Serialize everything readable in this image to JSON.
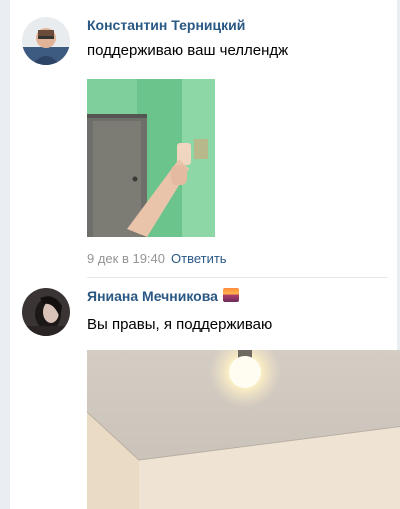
{
  "comments": [
    {
      "author": "Константин Терницкий",
      "text": "поддерживаю ваш челлендж",
      "date": "9 дек в 19:40",
      "reply_label": "Ответить",
      "avatar_icon": "user-photo-avatar",
      "photo_icon": "hand-on-green-wall-photo"
    },
    {
      "author": "Яниана Мечникова",
      "author_emoji_icon": "sunset-emoji-icon",
      "text": "Вы правы, я поддерживаю",
      "avatar_icon": "user-photo-avatar",
      "photo_icon": "ceiling-lightbulb-photo"
    }
  ],
  "colors": {
    "link": "#2a5885",
    "date": "#939393",
    "frame": "#eaedf1"
  }
}
